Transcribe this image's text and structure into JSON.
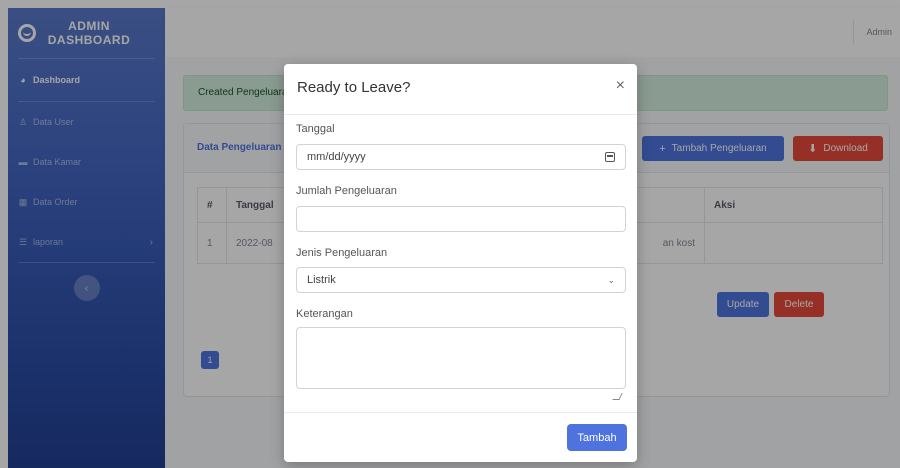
{
  "sidebar": {
    "brand_line1": "ADMIN",
    "brand_line2": "DASHBOARD",
    "items": [
      {
        "label": "Dashboard",
        "icon": "tachometer-icon"
      },
      {
        "label": "Data User",
        "icon": "user-icon"
      },
      {
        "label": "Data Kamar",
        "icon": "bed-icon"
      },
      {
        "label": "Data Order",
        "icon": "table-icon"
      },
      {
        "label": "laporan",
        "icon": "list-icon"
      }
    ],
    "toggle": "‹"
  },
  "topbar": {
    "user": "Admin"
  },
  "alert": {
    "text": "Created Pengeluaran"
  },
  "card": {
    "title": "Data Pengeluaran",
    "add_button": "Tambah Pengeluaran",
    "download_button": "Download",
    "table": {
      "headers": [
        "#",
        "Tanggal",
        "Aksi"
      ],
      "row": {
        "num": "1",
        "date": "2022-08",
        "keterangan": "an kost"
      },
      "update_button": "Update",
      "delete_button": "Delete"
    },
    "page": "1"
  },
  "modal": {
    "title": "Ready to Leave?",
    "close": "×",
    "tanggal_label": "Tanggal",
    "tanggal_placeholder": "mm/dd/yyyy",
    "jumlah_label": "Jumlah Pengeluaran",
    "jenis_label": "Jenis Pengeluaran",
    "jenis_value": "Listrik",
    "keterangan_label": "Keterangan",
    "submit": "Tambah"
  },
  "colors": {
    "primary": "#4e73df",
    "danger": "#e74a3b",
    "success_bg": "#d4efdf"
  }
}
